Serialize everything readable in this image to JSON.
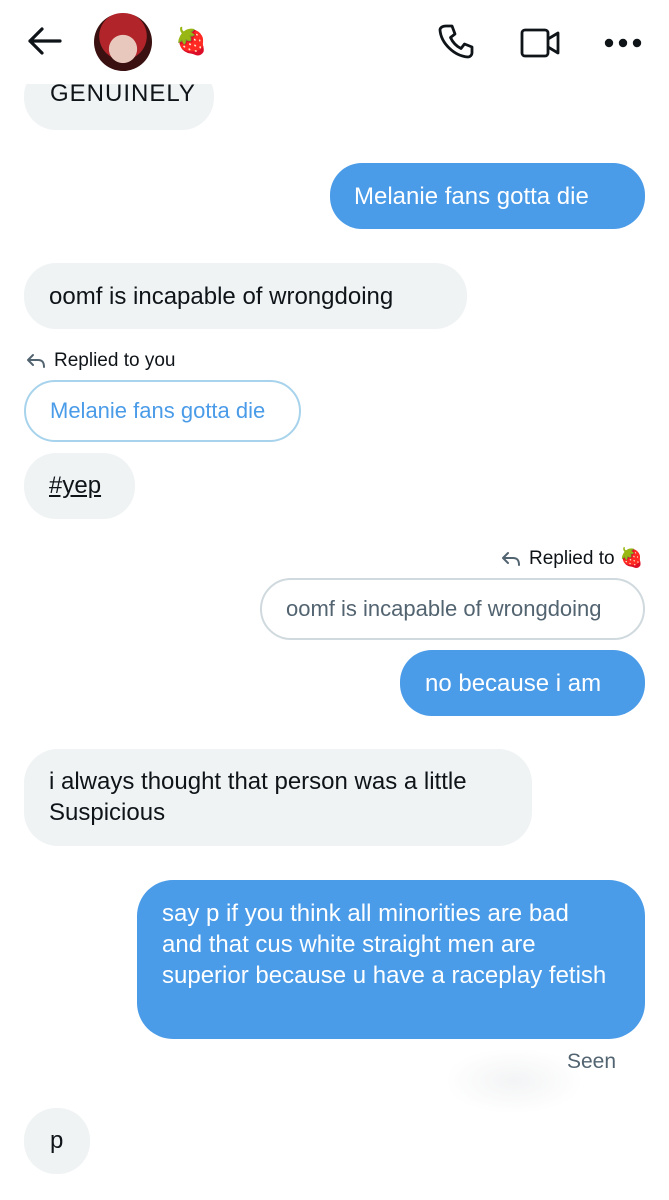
{
  "header": {
    "back_icon": "arrow-left-icon",
    "avatar_icon": "profile-avatar",
    "name_emoji": "🍓",
    "call_icon": "phone-icon",
    "video_icon": "video-camera-icon",
    "more_icon": "more-dots-icon"
  },
  "messages": {
    "m0": "GENUINELY",
    "m1": "Melanie fans gotta die",
    "m2": "oomf is incapable of wrongdoing",
    "m3_reply_label": "Replied to you",
    "m3_quote": "Melanie fans gotta die",
    "m3": "#yep",
    "m4_reply_label": "Replied to",
    "m4_reply_emoji": "🍓",
    "m4_quote": "oomf is incapable of wrongdoing",
    "m4": "no because i am",
    "m5": "i always thought that person was a little Suspicious",
    "m6": "say p if you think all minorities are bad and that cus white straight men are superior because u have a raceplay fetish",
    "seen": "Seen",
    "m7": "p"
  },
  "colors": {
    "outgoing_bubble": "#4a9be8",
    "incoming_bubble": "#eff3f4",
    "quote_border_blue": "#a8d3ec",
    "quote_text_blue": "#4a9be8"
  }
}
